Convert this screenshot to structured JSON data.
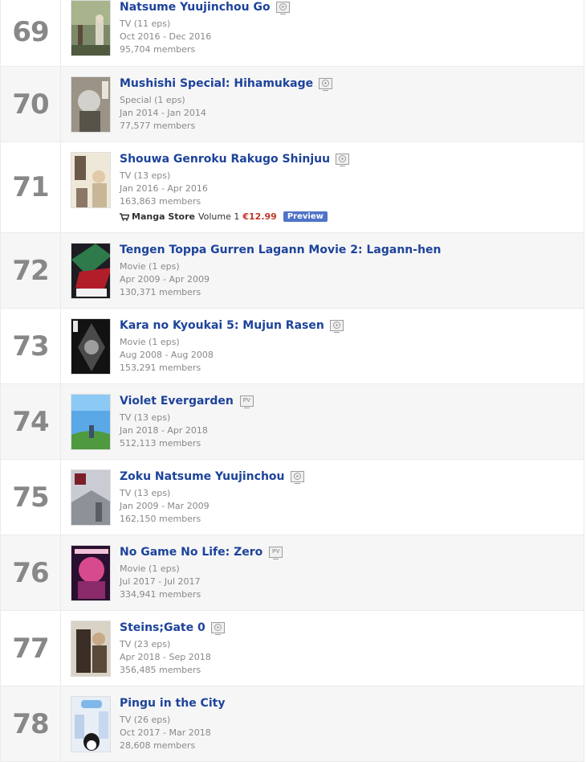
{
  "rows": [
    {
      "rank": "69",
      "title": "Natsume Yuujinchou Go",
      "icon": "play-video-icon",
      "type": "TV (11 eps)",
      "dates": "Oct 2016 - Dec 2016",
      "members": "95,704 members"
    },
    {
      "rank": "70",
      "title": "Mushishi Special: Hihamukage",
      "icon": "play-video-icon",
      "type": "Special (1 eps)",
      "dates": "Jan 2014 - Jan 2014",
      "members": "77,577 members"
    },
    {
      "rank": "71",
      "title": "Shouwa Genroku Rakugo Shinjuu",
      "icon": "play-video-icon",
      "type": "TV (13 eps)",
      "dates": "Jan 2016 - Apr 2016",
      "members": "163,863 members",
      "store": {
        "name": "Manga Store",
        "volume": "Volume 1",
        "price": "€12.99",
        "preview": "Preview"
      }
    },
    {
      "rank": "72",
      "title": "Tengen Toppa Gurren Lagann Movie 2: Lagann-hen",
      "icon": "",
      "type": "Movie (1 eps)",
      "dates": "Apr 2009 - Apr 2009",
      "members": "130,371 members"
    },
    {
      "rank": "73",
      "title": "Kara no Kyoukai 5: Mujun Rasen",
      "icon": "play-video-icon",
      "type": "Movie (1 eps)",
      "dates": "Aug 2008 - Aug 2008",
      "members": "153,291 members"
    },
    {
      "rank": "74",
      "title": "Violet Evergarden",
      "icon": "pv-icon",
      "pv_label": "PV",
      "type": "TV (13 eps)",
      "dates": "Jan 2018 - Apr 2018",
      "members": "512,113 members"
    },
    {
      "rank": "75",
      "title": "Zoku Natsume Yuujinchou",
      "icon": "play-video-icon",
      "type": "TV (13 eps)",
      "dates": "Jan 2009 - Mar 2009",
      "members": "162,150 members"
    },
    {
      "rank": "76",
      "title": "No Game No Life: Zero",
      "icon": "pv-icon",
      "pv_label": "PV",
      "type": "Movie (1 eps)",
      "dates": "Jul 2017 - Jul 2017",
      "members": "334,941 members"
    },
    {
      "rank": "77",
      "title": "Steins;Gate 0",
      "icon": "play-video-icon",
      "type": "TV (23 eps)",
      "dates": "Apr 2018 - Sep 2018",
      "members": "356,485 members"
    },
    {
      "rank": "78",
      "title": "Pingu in the City",
      "icon": "",
      "type": "TV (26 eps)",
      "dates": "Oct 2017 - Mar 2018",
      "members": "28,608 members"
    }
  ],
  "colors": {
    "title": "#1d439b",
    "rank": "#888888",
    "meta": "#888888",
    "price": "#c0392b",
    "preview_bg": "#4f74c8",
    "row_alt": "#f6f6f6"
  }
}
